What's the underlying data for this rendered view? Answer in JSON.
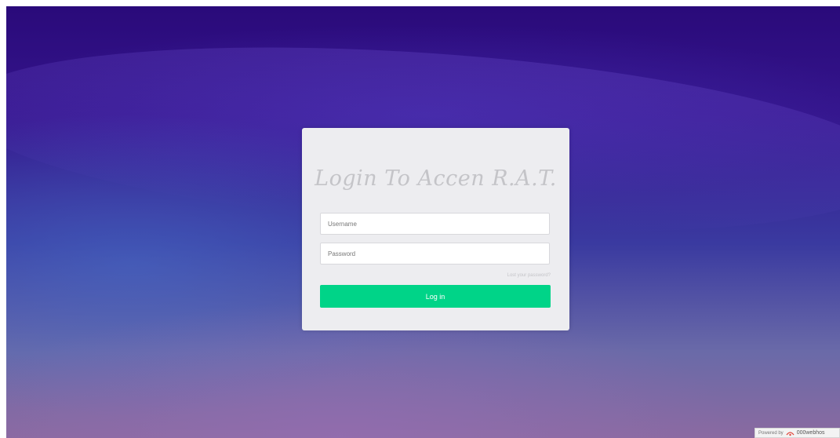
{
  "login": {
    "title": "Login To Accen R.A.T.",
    "username_placeholder": "Username",
    "password_placeholder": "Password",
    "lost_password_link": "Lost your password?",
    "submit_label": "Log in"
  },
  "footer_badge": {
    "prefix": "Powered by",
    "brand": "000webhos"
  },
  "colors": {
    "accent": "#00d488",
    "card_background": "#ededf0",
    "background_top": "#2a0a7a"
  },
  "icons": {
    "badge_logo": "000webhost-logo-icon"
  }
}
